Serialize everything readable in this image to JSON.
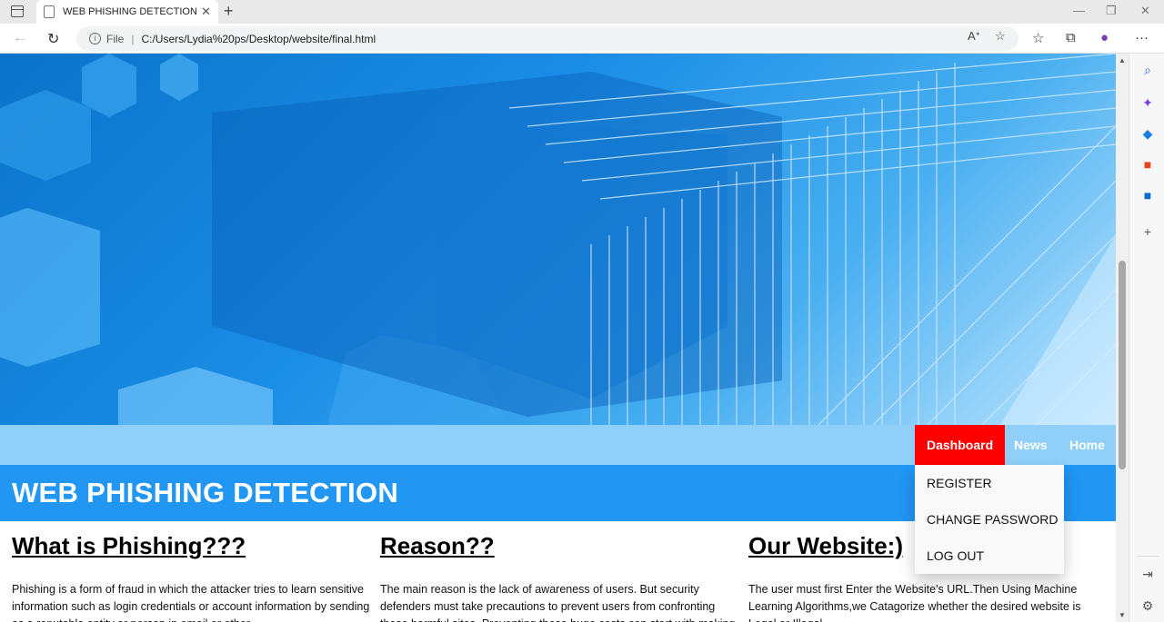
{
  "browser": {
    "tab_title": "WEB PHISHING DETECTION",
    "tab_close": "✕",
    "new_tab": "+",
    "address_file": "File",
    "address_sep": "|",
    "address_url": "C:/Users/Lydia%20ps/Desktop/website/final.html",
    "read_aloud": "Ä́",
    "menu": "···"
  },
  "page": {
    "nav": [
      {
        "label": "Dashboard"
      },
      {
        "label": "News"
      },
      {
        "label": "Home"
      }
    ],
    "dropdown": [
      {
        "label": "REGISTER"
      },
      {
        "label": "CHANGE PASSWORD"
      },
      {
        "label": "LOG OUT"
      }
    ],
    "banner_title": "WEB PHISHING DETECTION",
    "columns": [
      {
        "heading": "What is Phishing???",
        "text": "Phishing is a form of fraud in which the attacker tries to learn sensitive information such as login credentials or account information by sending as a reputable entity or person in email or other"
      },
      {
        "heading": "Reason??",
        "text": "The main reason is the lack of awareness of users. But security defenders must take precautions to prevent users from confronting these harmful sites. Preventing these huge costs can start with making"
      },
      {
        "heading": "Our Website:)",
        "text": "The user must first Enter the Website's URL.Then Using Machine Learning Algorithms,we Catagorize whether the desired website is Legal or Illegal."
      }
    ]
  },
  "colors": {
    "nav_strip": "#8fcff8",
    "banner": "#2196f3",
    "active_nav": "#ff0000"
  }
}
